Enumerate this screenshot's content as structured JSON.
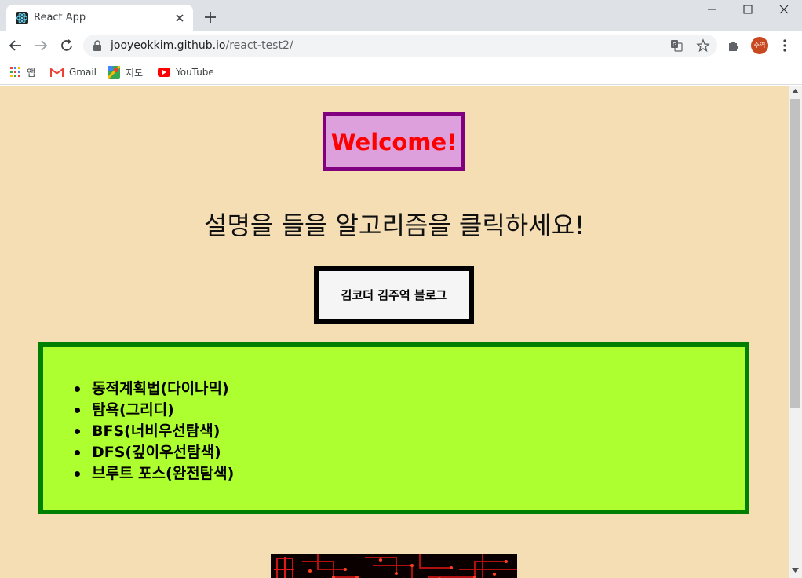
{
  "browser": {
    "tab_title": "React App",
    "url_host": "jooyeokkim.github.io",
    "url_path": "/react-test2/",
    "avatar_text": "주역",
    "bookmarks": [
      {
        "label": "앱",
        "icon": "apps-grid-icon"
      },
      {
        "label": "Gmail",
        "icon": "gmail-icon"
      },
      {
        "label": "지도",
        "icon": "maps-icon"
      },
      {
        "label": "YouTube",
        "icon": "youtube-icon"
      }
    ]
  },
  "page": {
    "welcome": "Welcome!",
    "instruction": "설명을 들을 알고리즘을 클릭하세요!",
    "blog_button": "김코더 김주역 블로그",
    "algorithms": [
      "동적계획법(다이나믹)",
      "탐욕(그리디)",
      "BFS(너비우선탐색)",
      "DFS(깊이우선탐색)",
      "브루트 포스(완전탐색)"
    ]
  },
  "colors": {
    "page_background": "#f5deb3",
    "welcome_bg": "#dda0dd",
    "welcome_border": "#800080",
    "welcome_text": "#ff0000",
    "algo_bg": "#adff2f",
    "algo_border": "#008000"
  }
}
